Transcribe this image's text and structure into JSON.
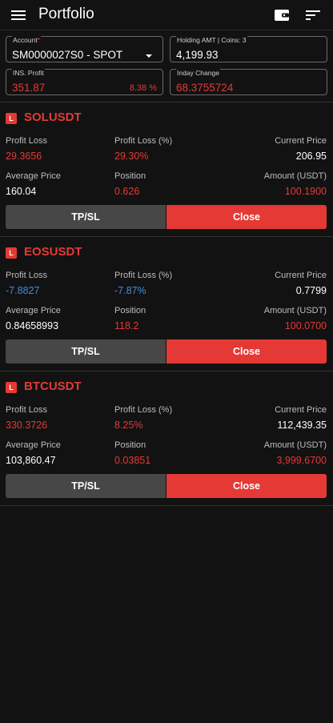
{
  "header": {
    "title": "Portfolio",
    "menu_icon": "hamburger-menu-icon",
    "wallet_icon": "wallet-icon",
    "sort_icon": "sort-icon"
  },
  "summary": {
    "account": {
      "label": "Account",
      "required_mark": "*",
      "value": "SM0000027S0 - SPOT"
    },
    "holding": {
      "label": "Holding AMT | Coins: 3",
      "value": "4,199.93"
    },
    "ins_profit": {
      "label": "INS. Profit",
      "value": "351.87",
      "percent": "8.38 %"
    },
    "inday_change": {
      "label": "Inday Change",
      "value": "68.3755724"
    }
  },
  "labels": {
    "profit_loss": "Profit Loss",
    "profit_loss_pct": "Profit Loss (%)",
    "current_price": "Current Price",
    "average_price": "Average Price",
    "position": "Position",
    "amount": "Amount (USDT)",
    "tpsl": "TP/SL",
    "close": "Close",
    "badge": "L"
  },
  "positions": [
    {
      "symbol": "SOLUSDT",
      "profit_loss": "29.3656",
      "profit_loss_pct": "29.30%",
      "current_price": "206.95",
      "average_price": "160.04",
      "position": "0.626",
      "amount": "100.1900"
    },
    {
      "symbol": "EOSUSDT",
      "profit_loss": "-7.8827",
      "profit_loss_pct": "-7.87%",
      "current_price": "0.7799",
      "average_price": "0.84658993",
      "position": "118.2",
      "amount": "100.0700"
    },
    {
      "symbol": "BTCUSDT",
      "profit_loss": "330.3726",
      "profit_loss_pct": "8.25%",
      "current_price": "112,439.35",
      "average_price": "103,860.47",
      "position": "0.03851",
      "amount": "3,999.6700"
    }
  ],
  "colors": {
    "background": "#121212",
    "accent_red": "#e53935",
    "negative_blue": "#3f8fe0",
    "button_gray": "#474747"
  }
}
